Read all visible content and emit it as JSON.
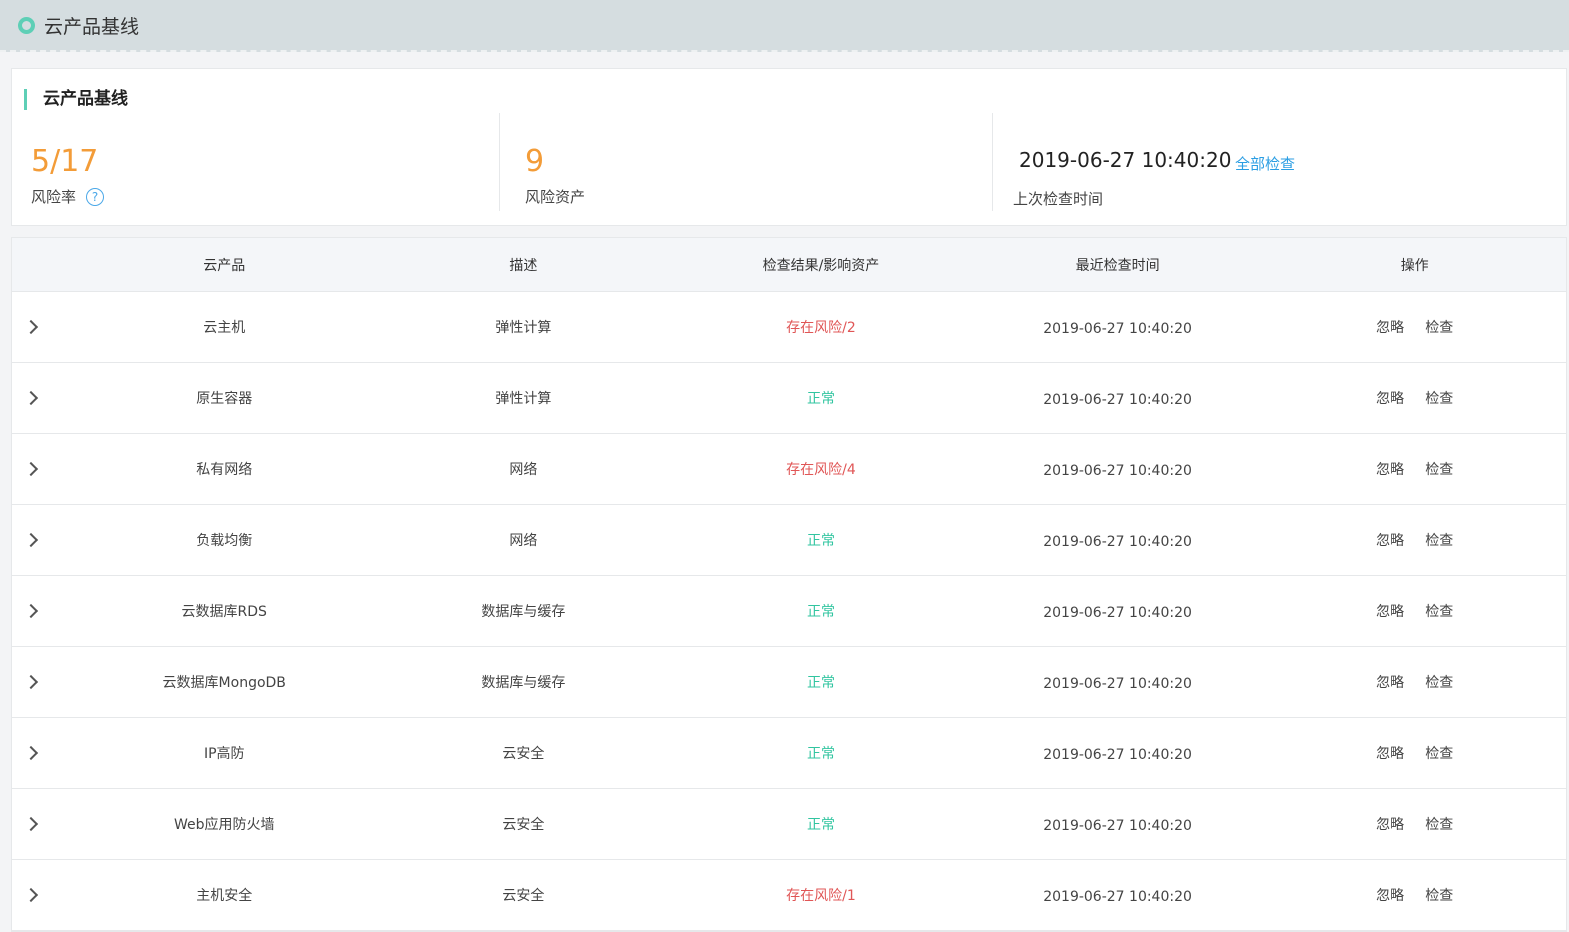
{
  "header": {
    "title": "云产品基线"
  },
  "summary": {
    "heading": "云产品基线",
    "risk_rate": {
      "value": "5/17",
      "label": "风险率",
      "help_icon": "?"
    },
    "risk_assets": {
      "value": "9",
      "label": "风险资产"
    },
    "last_check": {
      "time": "2019-06-27 10:40:20",
      "label": "上次检查时间",
      "check_all_label": "全部检查"
    }
  },
  "table": {
    "columns": [
      "云产品",
      "描述",
      "检查结果/影响资产",
      "最近检查时间",
      "操作"
    ],
    "rows": [
      {
        "product": "云主机",
        "desc": "弹性计算",
        "result": "存在风险/2",
        "status": "risk",
        "time": "2019-06-27 10:40:20",
        "ignore": "忽略",
        "check": "检查"
      },
      {
        "product": "原生容器",
        "desc": "弹性计算",
        "result": "正常",
        "status": "ok",
        "time": "2019-06-27 10:40:20",
        "ignore": "忽略",
        "check": "检查"
      },
      {
        "product": "私有网络",
        "desc": "网络",
        "result": "存在风险/4",
        "status": "risk",
        "time": "2019-06-27 10:40:20",
        "ignore": "忽略",
        "check": "检查"
      },
      {
        "product": "负载均衡",
        "desc": "网络",
        "result": "正常",
        "status": "ok",
        "time": "2019-06-27 10:40:20",
        "ignore": "忽略",
        "check": "检查"
      },
      {
        "product": "云数据库RDS",
        "desc": "数据库与缓存",
        "result": "正常",
        "status": "ok",
        "time": "2019-06-27 10:40:20",
        "ignore": "忽略",
        "check": "检查"
      },
      {
        "product": "云数据库MongoDB",
        "desc": "数据库与缓存",
        "result": "正常",
        "status": "ok",
        "time": "2019-06-27 10:40:20",
        "ignore": "忽略",
        "check": "检查"
      },
      {
        "product": "IP高防",
        "desc": "云安全",
        "result": "正常",
        "status": "ok",
        "time": "2019-06-27 10:40:20",
        "ignore": "忽略",
        "check": "检查"
      },
      {
        "product": "Web应用防火墙",
        "desc": "云安全",
        "result": "正常",
        "status": "ok",
        "time": "2019-06-27 10:40:20",
        "ignore": "忽略",
        "check": "检查"
      },
      {
        "product": "主机安全",
        "desc": "云安全",
        "result": "存在风险/1",
        "status": "risk",
        "time": "2019-06-27 10:40:20",
        "ignore": "忽略",
        "check": "检查"
      }
    ]
  },
  "colors": {
    "accent": "#5ecfb6",
    "risk": "#e05656",
    "ok": "#31c5a0",
    "link": "#2b9ee3",
    "number": "#f39c38"
  }
}
